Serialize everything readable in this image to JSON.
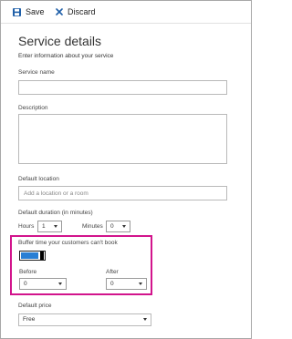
{
  "toolbar": {
    "save_label": "Save",
    "discard_label": "Discard"
  },
  "form": {
    "title": "Service details",
    "subtitle": "Enter information about your service",
    "service_name": {
      "label": "Service name",
      "value": ""
    },
    "description": {
      "label": "Description",
      "value": ""
    },
    "default_location": {
      "label": "Default location",
      "placeholder": "Add a location or a room"
    },
    "default_duration": {
      "label": "Default duration (in minutes)",
      "hours_label": "Hours",
      "hours_value": "1",
      "minutes_label": "Minutes",
      "minutes_value": "0"
    },
    "buffer": {
      "label": "Buffer time your customers can't book",
      "toggle_on": true,
      "before_label": "Before",
      "before_value": "0",
      "after_label": "After",
      "after_value": "0"
    },
    "default_price": {
      "label": "Default price",
      "value": "Free"
    }
  },
  "colors": {
    "accent": "#2a7fd4",
    "highlight": "#d2148c",
    "save_icon": "#1f5fa8"
  }
}
